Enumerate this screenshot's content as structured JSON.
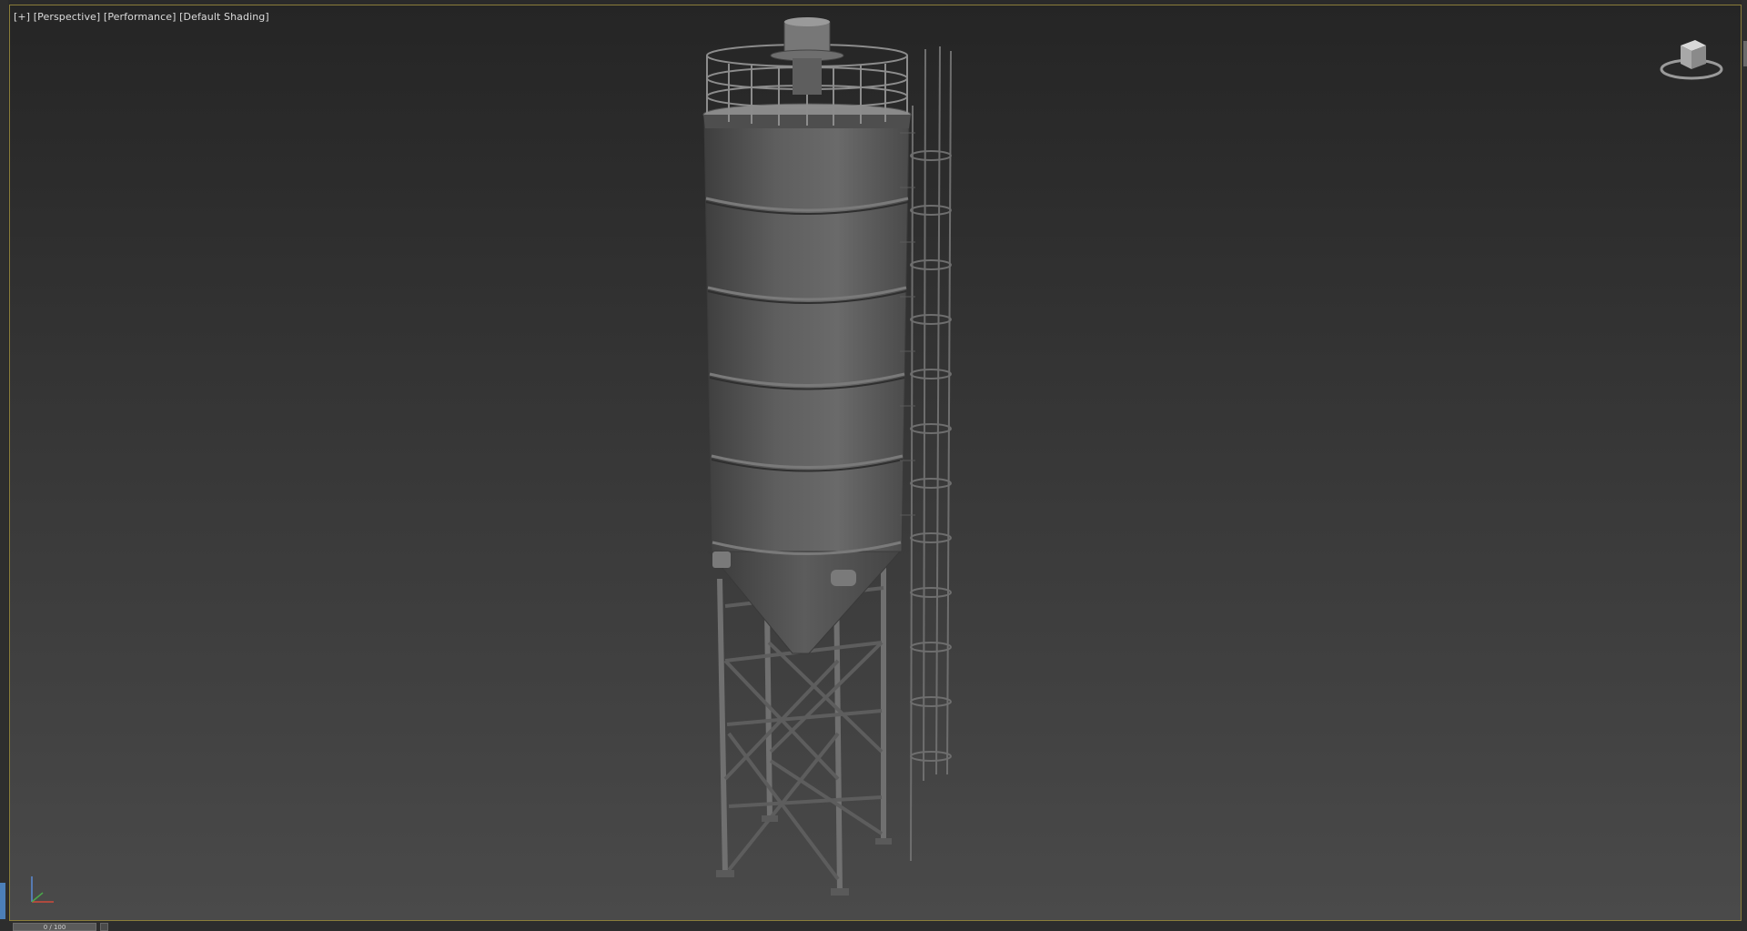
{
  "viewport": {
    "label_parts": [
      "[+]",
      "[Perspective]",
      "[Performance]",
      "[Default Shading]"
    ],
    "border_color": "#8a7d3a",
    "background_top": "#252525",
    "background_bottom": "#4a4a4a"
  },
  "scene": {
    "object": "silo-model",
    "shading_color": "#6b6b6b"
  },
  "navigation": {
    "viewcube_icon": "viewcube-icon",
    "axis_icon": "xyz-axis-gizmo-icon"
  },
  "timeline": {
    "slider_text": "0 / 100"
  }
}
